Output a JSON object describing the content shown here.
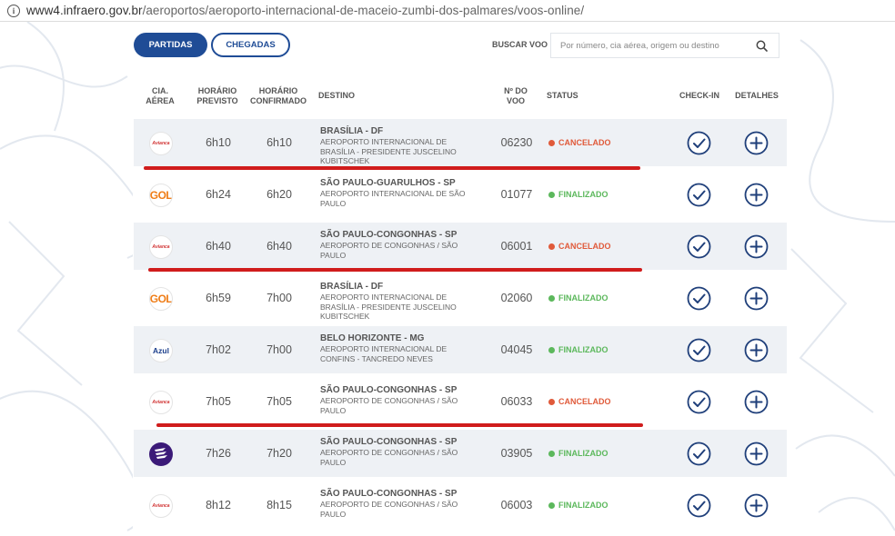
{
  "browser": {
    "url_domain": "www4.infraero.gov.br",
    "url_path": "/aeroportos/aeroporto-internacional-de-maceio-zumbi-dos-palmares/voos-online/"
  },
  "tabs": {
    "partidas": "PARTIDAS",
    "chegadas": "CHEGADAS"
  },
  "search": {
    "label": "BUSCAR VOO",
    "placeholder": "Por número, cia aérea, origem ou destino"
  },
  "columns": {
    "cia": [
      "CIA.",
      "AÉREA"
    ],
    "previsto": [
      "HORÁRIO",
      "PREVISTO"
    ],
    "confirmado": [
      "HORÁRIO",
      "CONFIRMADO"
    ],
    "destino": "DESTINO",
    "numero": [
      "Nº DO",
      "VOO"
    ],
    "status": "STATUS",
    "checkin": "CHECK-IN",
    "detalhes": "DETALHES"
  },
  "colors": {
    "primary": "#1f4c96",
    "cancelado": "#e05a3a",
    "finalizado": "#5cb85c",
    "annotation": "#d01c1c"
  },
  "flights": [
    {
      "airline_icon": "avianca-logo",
      "airline_text": "Avianca",
      "previsto": "6h10",
      "confirmado": "6h10",
      "city": "BRASÍLIA - DF",
      "airport": "AEROPORTO INTERNACIONAL DE BRASÍLIA - PRESIDENTE JUSCELINO KUBITSCHEK",
      "number": "06230",
      "status": "CANCELADO",
      "struck": true
    },
    {
      "airline_icon": "gol-logo",
      "airline_text": "GOL",
      "previsto": "6h24",
      "confirmado": "6h20",
      "city": "SÃO PAULO-GUARULHOS - SP",
      "airport": "AEROPORTO INTERNACIONAL DE SÃO PAULO",
      "number": "01077",
      "status": "FINALIZADO",
      "struck": false
    },
    {
      "airline_icon": "avianca-logo",
      "airline_text": "Avianca",
      "previsto": "6h40",
      "confirmado": "6h40",
      "city": "SÃO PAULO-CONGONHAS - SP",
      "airport": "AEROPORTO DE CONGONHAS / SÃO PAULO",
      "number": "06001",
      "status": "CANCELADO",
      "struck": true
    },
    {
      "airline_icon": "gol-logo",
      "airline_text": "GOL",
      "previsto": "6h59",
      "confirmado": "7h00",
      "city": "BRASÍLIA - DF",
      "airport": "AEROPORTO INTERNACIONAL DE BRASÍLIA - PRESIDENTE JUSCELINO KUBITSCHEK",
      "number": "02060",
      "status": "FINALIZADO",
      "struck": false
    },
    {
      "airline_icon": "azul-logo",
      "airline_text": "Azul",
      "previsto": "7h02",
      "confirmado": "7h00",
      "city": "BELO HORIZONTE - MG",
      "airport": "AEROPORTO INTERNACIONAL DE CONFINS - TANCREDO NEVES",
      "number": "04045",
      "status": "FINALIZADO",
      "struck": false
    },
    {
      "airline_icon": "avianca-logo",
      "airline_text": "Avianca",
      "previsto": "7h05",
      "confirmado": "7h05",
      "city": "SÃO PAULO-CONGONHAS - SP",
      "airport": "AEROPORTO DE CONGONHAS / SÃO PAULO",
      "number": "06033",
      "status": "CANCELADO",
      "struck": true
    },
    {
      "airline_icon": "latam-logo",
      "airline_text": "",
      "previsto": "7h26",
      "confirmado": "7h20",
      "city": "SÃO PAULO-CONGONHAS - SP",
      "airport": "AEROPORTO DE CONGONHAS / SÃO PAULO",
      "number": "03905",
      "status": "FINALIZADO",
      "struck": false
    },
    {
      "airline_icon": "avianca-logo",
      "airline_text": "Avianca",
      "previsto": "8h12",
      "confirmado": "8h15",
      "city": "SÃO PAULO-CONGONHAS - SP",
      "airport": "AEROPORTO DE CONGONHAS / SÃO PAULO",
      "number": "06003",
      "status": "FINALIZADO",
      "struck": false
    }
  ]
}
